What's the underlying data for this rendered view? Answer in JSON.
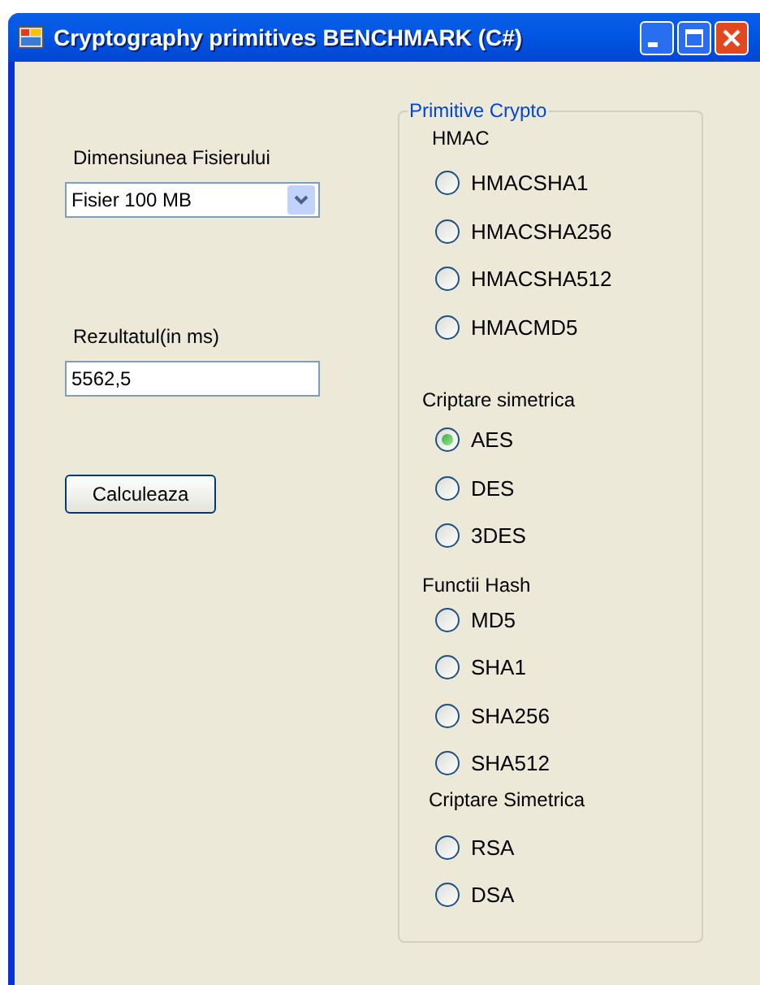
{
  "window": {
    "title": "Cryptography primitives BENCHMARK (C#)"
  },
  "file_size": {
    "label": "Dimensiunea Fisierului",
    "value": "Fisier 100 MB"
  },
  "result": {
    "label": "Rezultatul(in ms)",
    "value": "5562,5"
  },
  "calculate_button": "Calculeaza",
  "primitives": {
    "title": "Primitive Crypto",
    "sections": [
      {
        "heading": "HMAC",
        "options": [
          {
            "label": "HMACSHA1",
            "selected": false
          },
          {
            "label": "HMACSHA256",
            "selected": false
          },
          {
            "label": "HMACSHA512",
            "selected": false
          },
          {
            "label": "HMACMD5",
            "selected": false
          }
        ]
      },
      {
        "heading": "Criptare simetrica",
        "options": [
          {
            "label": "AES",
            "selected": true
          },
          {
            "label": "DES",
            "selected": false
          },
          {
            "label": "3DES",
            "selected": false
          }
        ]
      },
      {
        "heading": "Functii Hash",
        "options": [
          {
            "label": "MD5",
            "selected": false
          },
          {
            "label": "SHA1",
            "selected": false
          },
          {
            "label": "SHA256",
            "selected": false
          },
          {
            "label": "SHA512",
            "selected": false
          }
        ]
      },
      {
        "heading": "Criptare Simetrica",
        "options": [
          {
            "label": "RSA",
            "selected": false
          },
          {
            "label": "DSA",
            "selected": false
          }
        ]
      }
    ]
  }
}
